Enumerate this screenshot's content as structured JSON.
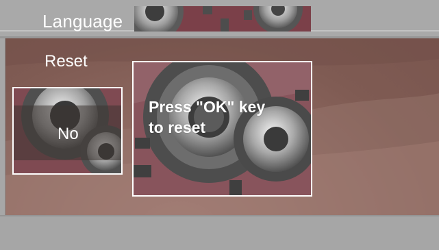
{
  "menu": {
    "language_label": "Language",
    "reset_label": "Reset"
  },
  "dialog": {
    "option_label": "No",
    "message_line1": "Press \"OK\" key",
    "message_line2": "to reset"
  },
  "colors": {
    "background_gray": "#a7a7a7",
    "content_brown": "#8a655d",
    "text": "#ffffff"
  }
}
